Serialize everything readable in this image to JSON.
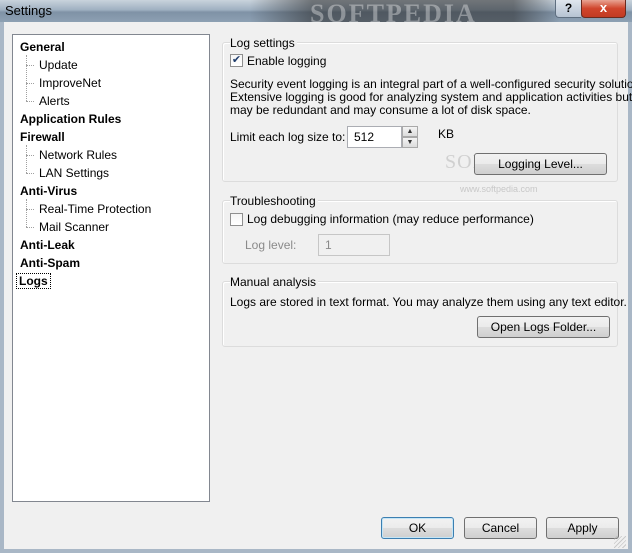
{
  "window": {
    "title": "Settings",
    "watermark": "SOFTPEDIA",
    "help_label": "?",
    "close_label": "x"
  },
  "tree": {
    "items": [
      {
        "label": "General",
        "level": 0
      },
      {
        "label": "Update",
        "level": 1
      },
      {
        "label": "ImproveNet",
        "level": 1
      },
      {
        "label": "Alerts",
        "level": 1
      },
      {
        "label": "Application Rules",
        "level": 0
      },
      {
        "label": "Firewall",
        "level": 0
      },
      {
        "label": "Network Rules",
        "level": 1
      },
      {
        "label": "LAN Settings",
        "level": 1
      },
      {
        "label": "Anti-Virus",
        "level": 0
      },
      {
        "label": "Real-Time Protection",
        "level": 1
      },
      {
        "label": "Mail Scanner",
        "level": 1
      },
      {
        "label": "Anti-Leak",
        "level": 0
      },
      {
        "label": "Anti-Spam",
        "level": 0
      },
      {
        "label": "Logs",
        "level": 0,
        "selected": true
      }
    ]
  },
  "log_settings": {
    "title": "Log settings",
    "enable_logging_label": "Enable logging",
    "enable_logging_checked": true,
    "description": "Security event logging is an integral part of a well-configured security solution. Extensive logging is good for analyzing system and application activities but may be redundant and may consume a lot of disk space.",
    "description_lines": [
      "Security event logging is an integral part of a well-configured security solution.",
      "Extensive logging is good for analyzing system and application activities but",
      "may be redundant and may consume a lot of disk space."
    ],
    "limit_label": "Limit each log size to:",
    "limit_value": "512",
    "limit_unit": "KB",
    "logging_level_button": "Logging Level..."
  },
  "troubleshooting": {
    "title": "Troubleshooting",
    "debug_label": "Log debugging information (may reduce performance)",
    "debug_checked": false,
    "log_level_label": "Log level:",
    "log_level_value": "1"
  },
  "manual_analysis": {
    "title": "Manual analysis",
    "description": "Logs are stored in text format. You may analyze them using any text editor.",
    "open_folder_button": "Open Logs Folder..."
  },
  "footer": {
    "ok": "OK",
    "cancel": "Cancel",
    "apply": "Apply"
  },
  "watermark_overlay": {
    "logo": "SOFTPEDIA",
    "url": "www.softpedia.com"
  }
}
